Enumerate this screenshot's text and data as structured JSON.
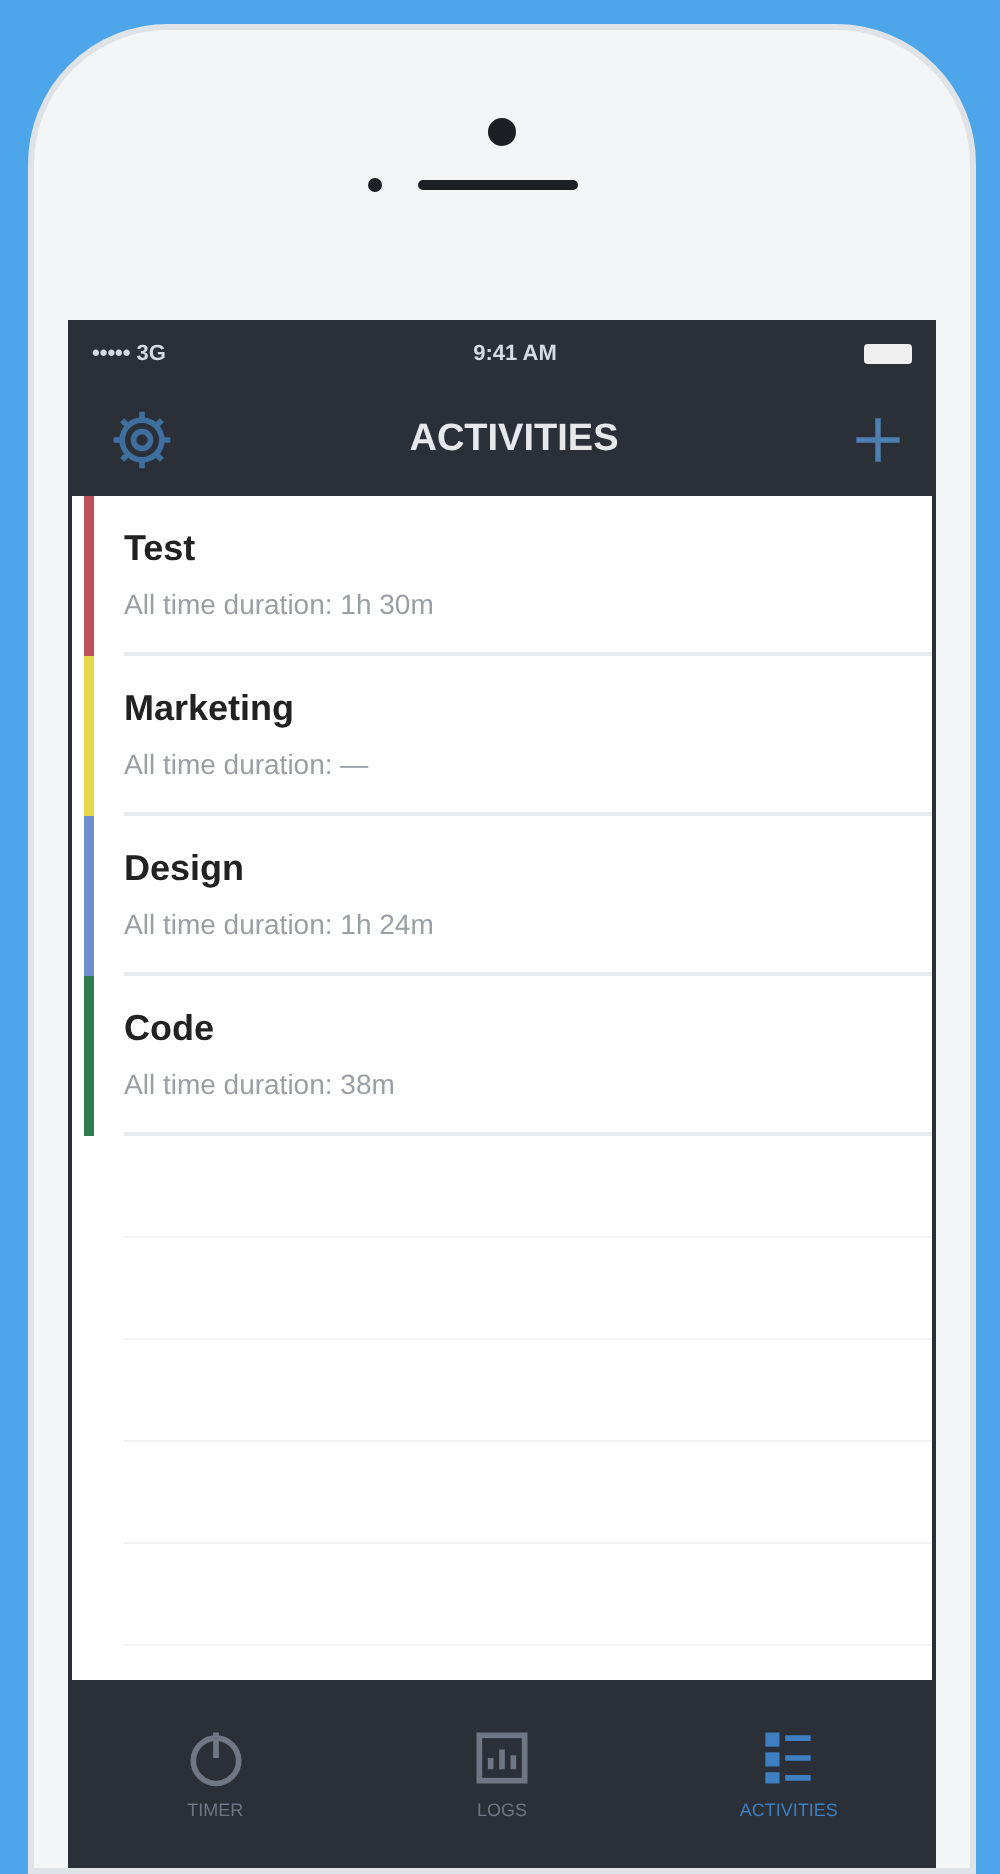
{
  "status_bar": {
    "carrier": "••••• 3G",
    "time": "9:41 AM"
  },
  "nav_bar": {
    "title": "ACTIVITIES"
  },
  "activities": [
    {
      "name": "Test",
      "duration": "All time duration: 1h 30m",
      "color": "#c0505a"
    },
    {
      "name": "Marketing",
      "duration": "All time duration: —",
      "color": "#e8d64a"
    },
    {
      "name": "Design",
      "duration": "All time duration: 1h 24m",
      "color": "#6f8fcf"
    },
    {
      "name": "Code",
      "duration": "All time duration: 38m",
      "color": "#2e7d4f"
    }
  ],
  "tab_bar": [
    {
      "label": "TIMER",
      "kind": "timer",
      "selected": false
    },
    {
      "label": "LOGS",
      "kind": "logs",
      "selected": false
    },
    {
      "label": "ACTIVITIES",
      "kind": "activities",
      "selected": true
    }
  ]
}
